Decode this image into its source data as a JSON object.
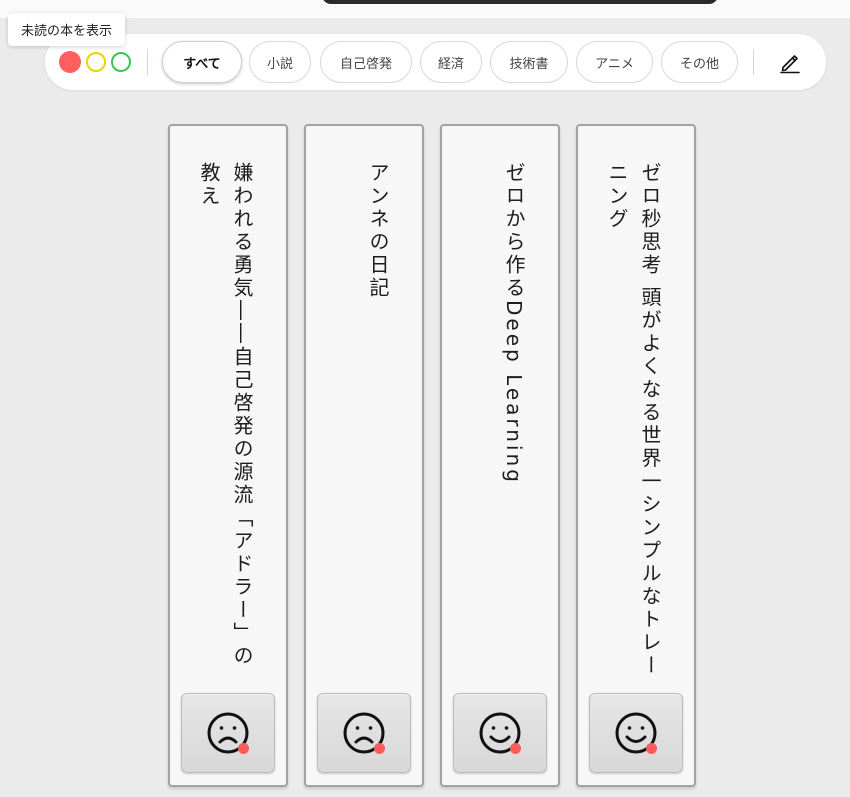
{
  "tooltip": {
    "text": "未読の本を表示"
  },
  "window_controls": {
    "close": {
      "icon": "close-dot-icon",
      "color": "#ff5f5f"
    },
    "minimize": {
      "icon": "minimize-dot-icon",
      "color": "#ecd400"
    },
    "maximize": {
      "icon": "maximize-dot-icon",
      "color": "#3cc451"
    }
  },
  "tabs": [
    {
      "label": "すべて",
      "active": true
    },
    {
      "label": "小説",
      "active": false
    },
    {
      "label": "自己啓発",
      "active": false
    },
    {
      "label": "経済",
      "active": false
    },
    {
      "label": "技術書",
      "active": false
    },
    {
      "label": "アニメ",
      "active": false
    },
    {
      "label": "その他",
      "active": false
    }
  ],
  "edit": {
    "icon": "pencil-icon"
  },
  "books": [
    {
      "title": "嫌われる勇気――自己啓発の源流「アドラー」の教え",
      "mood": "sad",
      "mood_icon": "sad-face-icon",
      "unread": true
    },
    {
      "title": "アンネの日記",
      "mood": "sad",
      "mood_icon": "sad-face-icon",
      "unread": true
    },
    {
      "title": "ゼロから作るDeep Learning",
      "mood": "happy",
      "mood_icon": "smile-face-icon",
      "unread": true
    },
    {
      "title": "ゼロ秒思考 頭がよくなる世界一シンプルなトレーニング",
      "mood": "happy",
      "mood_icon": "smile-face-icon",
      "unread": true
    }
  ],
  "colors": {
    "unread_dot": "#ff5b5b",
    "background": "#ebebeb"
  }
}
